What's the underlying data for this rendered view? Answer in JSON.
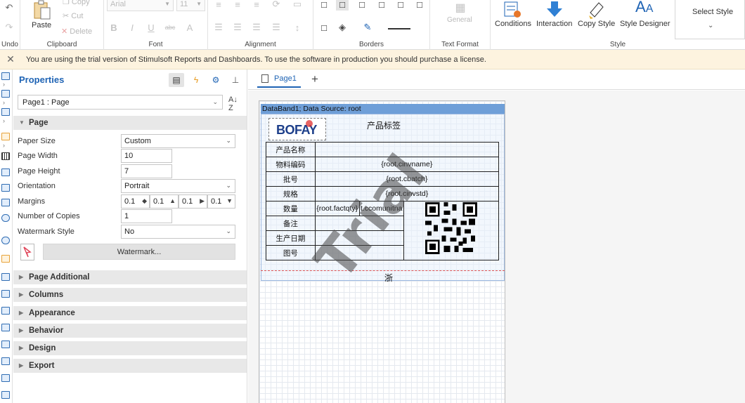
{
  "ribbon": {
    "undo": {
      "label": "Undo"
    },
    "clipboard": {
      "group": "Clipboard",
      "paste": "Paste",
      "copy": "Copy",
      "cut": "Cut",
      "delete": "Delete"
    },
    "font": {
      "group": "Font",
      "family": "Arial",
      "size": "11"
    },
    "alignment": {
      "group": "Alignment"
    },
    "borders": {
      "group": "Borders"
    },
    "text_format": {
      "group": "Text Format",
      "value": "General"
    },
    "style": {
      "group": "Style",
      "conditions": "Conditions",
      "interaction": "Interaction",
      "copy_style": "Copy Style",
      "style_designer": "Style Designer",
      "select_style": "Select Style"
    }
  },
  "trial": {
    "message": "You are using the trial version of Stimulsoft Reports and Dashboards. To use the software in production you should purchase a license."
  },
  "properties": {
    "title": "Properties",
    "object": "Page1 : Page",
    "sections": {
      "page": "Page",
      "page_additional": "Page Additional",
      "columns": "Columns",
      "appearance": "Appearance",
      "behavior": "Behavior",
      "design": "Design",
      "export": "Export"
    },
    "fields": {
      "paper_size": {
        "label": "Paper Size",
        "value": "Custom"
      },
      "page_width": {
        "label": "Page Width",
        "value": "10"
      },
      "page_height": {
        "label": "Page Height",
        "value": "7"
      },
      "orientation": {
        "label": "Orientation",
        "value": "Portrait"
      },
      "margins": {
        "label": "Margins",
        "values": [
          "0.1",
          "0.1",
          "0.1",
          "0.1"
        ]
      },
      "copies": {
        "label": "Number of Copies",
        "value": "1"
      },
      "watermark_style": {
        "label": "Watermark Style",
        "value": "No"
      }
    },
    "watermark_button": "Watermark..."
  },
  "designer": {
    "tab": "Page1",
    "band_header": "DataBand1; Data Source: root",
    "logo_text": "BOFAY",
    "title": "产品标签",
    "rows": [
      {
        "label": "产品名称",
        "value": ""
      },
      {
        "label": "物料编码",
        "value": "{root.cinvname}"
      },
      {
        "label": "批号",
        "value": "{root.cbatch}"
      },
      {
        "label": "规格",
        "value": "{root.cinvstd}"
      },
      {
        "label": "数量",
        "value": "{root.factqty}",
        "value2": "t.ccomunitna"
      },
      {
        "label": "备注",
        "value": ""
      },
      {
        "label": "生产日期",
        "value": ""
      },
      {
        "label": "图号",
        "value": ""
      }
    ],
    "footer": "浙",
    "watermark": "Trial"
  },
  "colors": {
    "accent": "#1e63b4",
    "trial_bg": "#fdf3df",
    "band_header": "#6f9fd8"
  }
}
